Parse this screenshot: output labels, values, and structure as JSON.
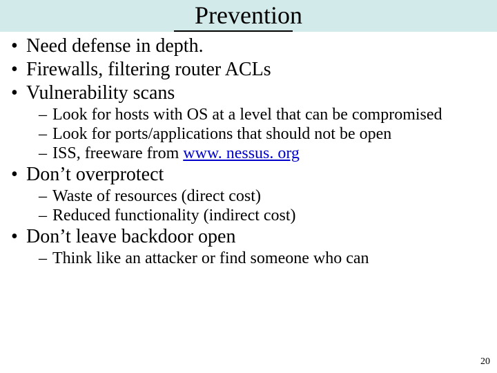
{
  "title": "Prevention",
  "bullets": {
    "b1": "Need defense in depth.",
    "b2": "Firewalls, filtering router ACLs",
    "b3": "Vulnerability scans",
    "b3a": "Look for hosts with OS at a level that can be compromised",
    "b3b": "Look for ports/applications that should not be open",
    "b3c_pre": "ISS, freeware from ",
    "b3c_link": "www. nessus. org",
    "b4": "Don’t overprotect",
    "b4a": "Waste of resources (direct cost)",
    "b4b": "Reduced functionality (indirect cost)",
    "b5": "Don’t leave backdoor open",
    "b5a": "Think like an attacker or find someone who can"
  },
  "page_number": "20"
}
